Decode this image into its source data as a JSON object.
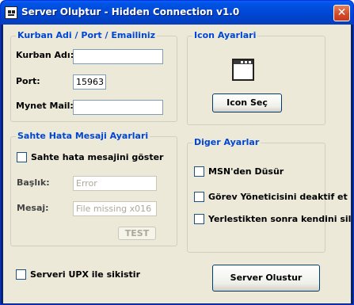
{
  "window": {
    "title": "Server Oluþtur - Hidden Connection v1.0",
    "close": "✕"
  },
  "group_account": {
    "title": "Kurban Adi / Port / Emailiniz",
    "name_label": "Kurban Adı:",
    "name_value": "",
    "port_label": "Port:",
    "port_value": "15963",
    "mail_label": "Mynet Mail:",
    "mail_value": ""
  },
  "group_icon": {
    "title": "Icon Ayarlari",
    "icon_name": "window-icon",
    "button": "Icon Seç"
  },
  "group_fake_error": {
    "title": "Sahte Hata Mesaji Ayarlari",
    "show_checkbox": "Sahte hata mesajini göster",
    "show_checked": false,
    "title_label": "Başlık:",
    "title_value": "Error",
    "message_label": "Mesaj:",
    "message_value": "File missing x016",
    "test_button": "TEST"
  },
  "group_other": {
    "title": "Diger Ayarlar",
    "options": [
      {
        "label": "MSN'den Düsür",
        "checked": false
      },
      {
        "label": "Görev Yöneticisini deaktif et",
        "checked": false
      },
      {
        "label": "Yerlestikten sonra kendini sil",
        "checked": false
      }
    ]
  },
  "footer": {
    "upx_checkbox": "Serveri UPX ile sikistir",
    "upx_checked": false,
    "create_button": "Server Olustur"
  },
  "colors": {
    "titlebar": "#0054e3",
    "group_title": "#0046d5",
    "face": "#ece9d8"
  }
}
